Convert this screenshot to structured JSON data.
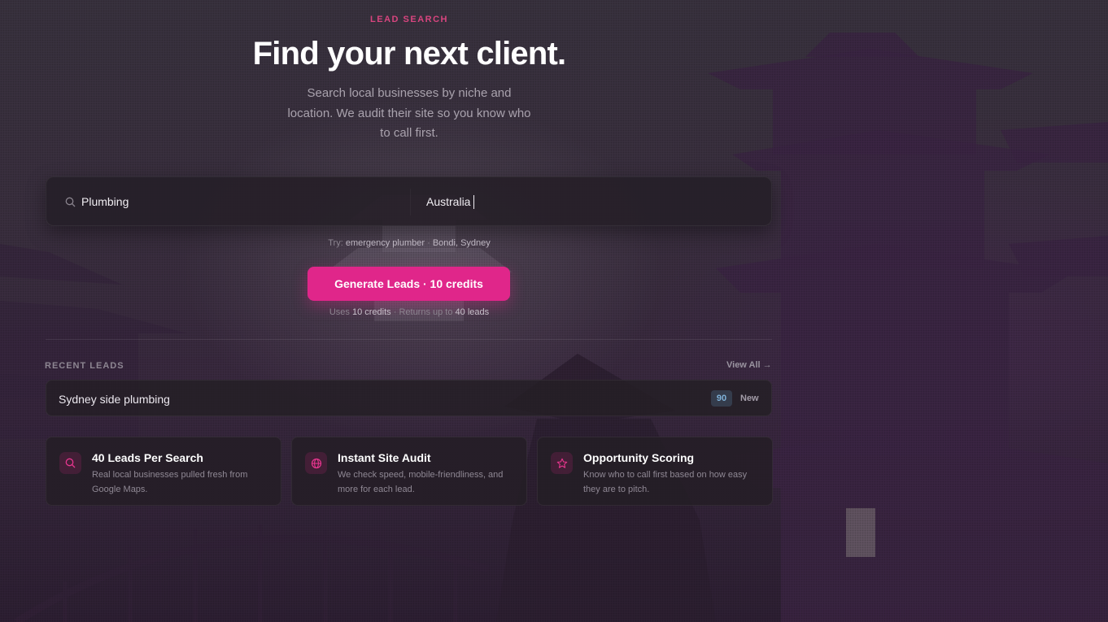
{
  "header": {
    "eyebrow": "LEAD SEARCH",
    "title": "Find your next client.",
    "subtitle": "Search local businesses by niche and location. We audit their site so you know who to call first."
  },
  "search": {
    "niche_value": "Plumbing",
    "location_value": "Australia",
    "try_prefix": "Try:",
    "try_niche": "emergency plumber",
    "try_sep": " · ",
    "try_location": "Bondi, Sydney"
  },
  "generate": {
    "button_label": "Generate Leads · 10 credits",
    "uses_prefix": "Uses ",
    "uses_credits": "10 credits",
    "uses_mid": " · Returns up to ",
    "uses_leads": "40 leads"
  },
  "recent": {
    "section_label": "RECENT LEADS",
    "view_all": "View All →",
    "items": [
      {
        "name": "Sydney side plumbing",
        "score": "90",
        "status": "New"
      }
    ]
  },
  "features": [
    {
      "icon": "search-icon",
      "title": "40 Leads Per Search",
      "desc": "Real local businesses pulled fresh from Google Maps."
    },
    {
      "icon": "globe-icon",
      "title": "Instant Site Audit",
      "desc": "We check speed, mobile-friendliness, and more for each lead."
    },
    {
      "icon": "star-icon",
      "title": "Opportunity Scoring",
      "desc": "Know who to call first based on how easy they are to pitch."
    }
  ],
  "colors": {
    "accent": "#e0268a",
    "eyebrow": "#d8457f",
    "score": "#7fb2d9"
  }
}
